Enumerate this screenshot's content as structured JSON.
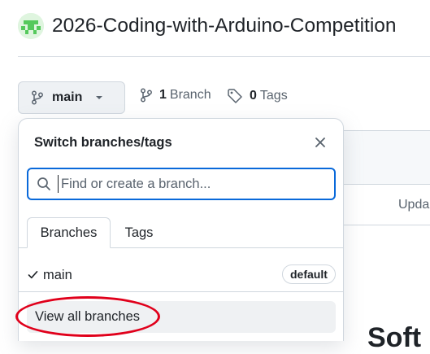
{
  "repo": {
    "name": "2026-Coding-with-Arduino-Competition",
    "avatar_icon": "identicon-avatar"
  },
  "branch_button": {
    "label": "main"
  },
  "meta": {
    "branch_count": "1",
    "branch_word": "Branch",
    "tag_count": "0",
    "tag_word": "Tags"
  },
  "background": {
    "upda": "Upda",
    "soft": "Soft"
  },
  "dropdown": {
    "title": "Switch branches/tags",
    "search_placeholder": "Find or create a branch...",
    "tabs": [
      {
        "label": "Branches"
      },
      {
        "label": "Tags"
      }
    ],
    "branches": [
      {
        "name": "main",
        "badge": "default",
        "selected": true
      }
    ],
    "view_all": "View all branches"
  },
  "colors": {
    "accent": "#0969da",
    "annotation": "#e0001b",
    "identicon": "#55c95c"
  }
}
